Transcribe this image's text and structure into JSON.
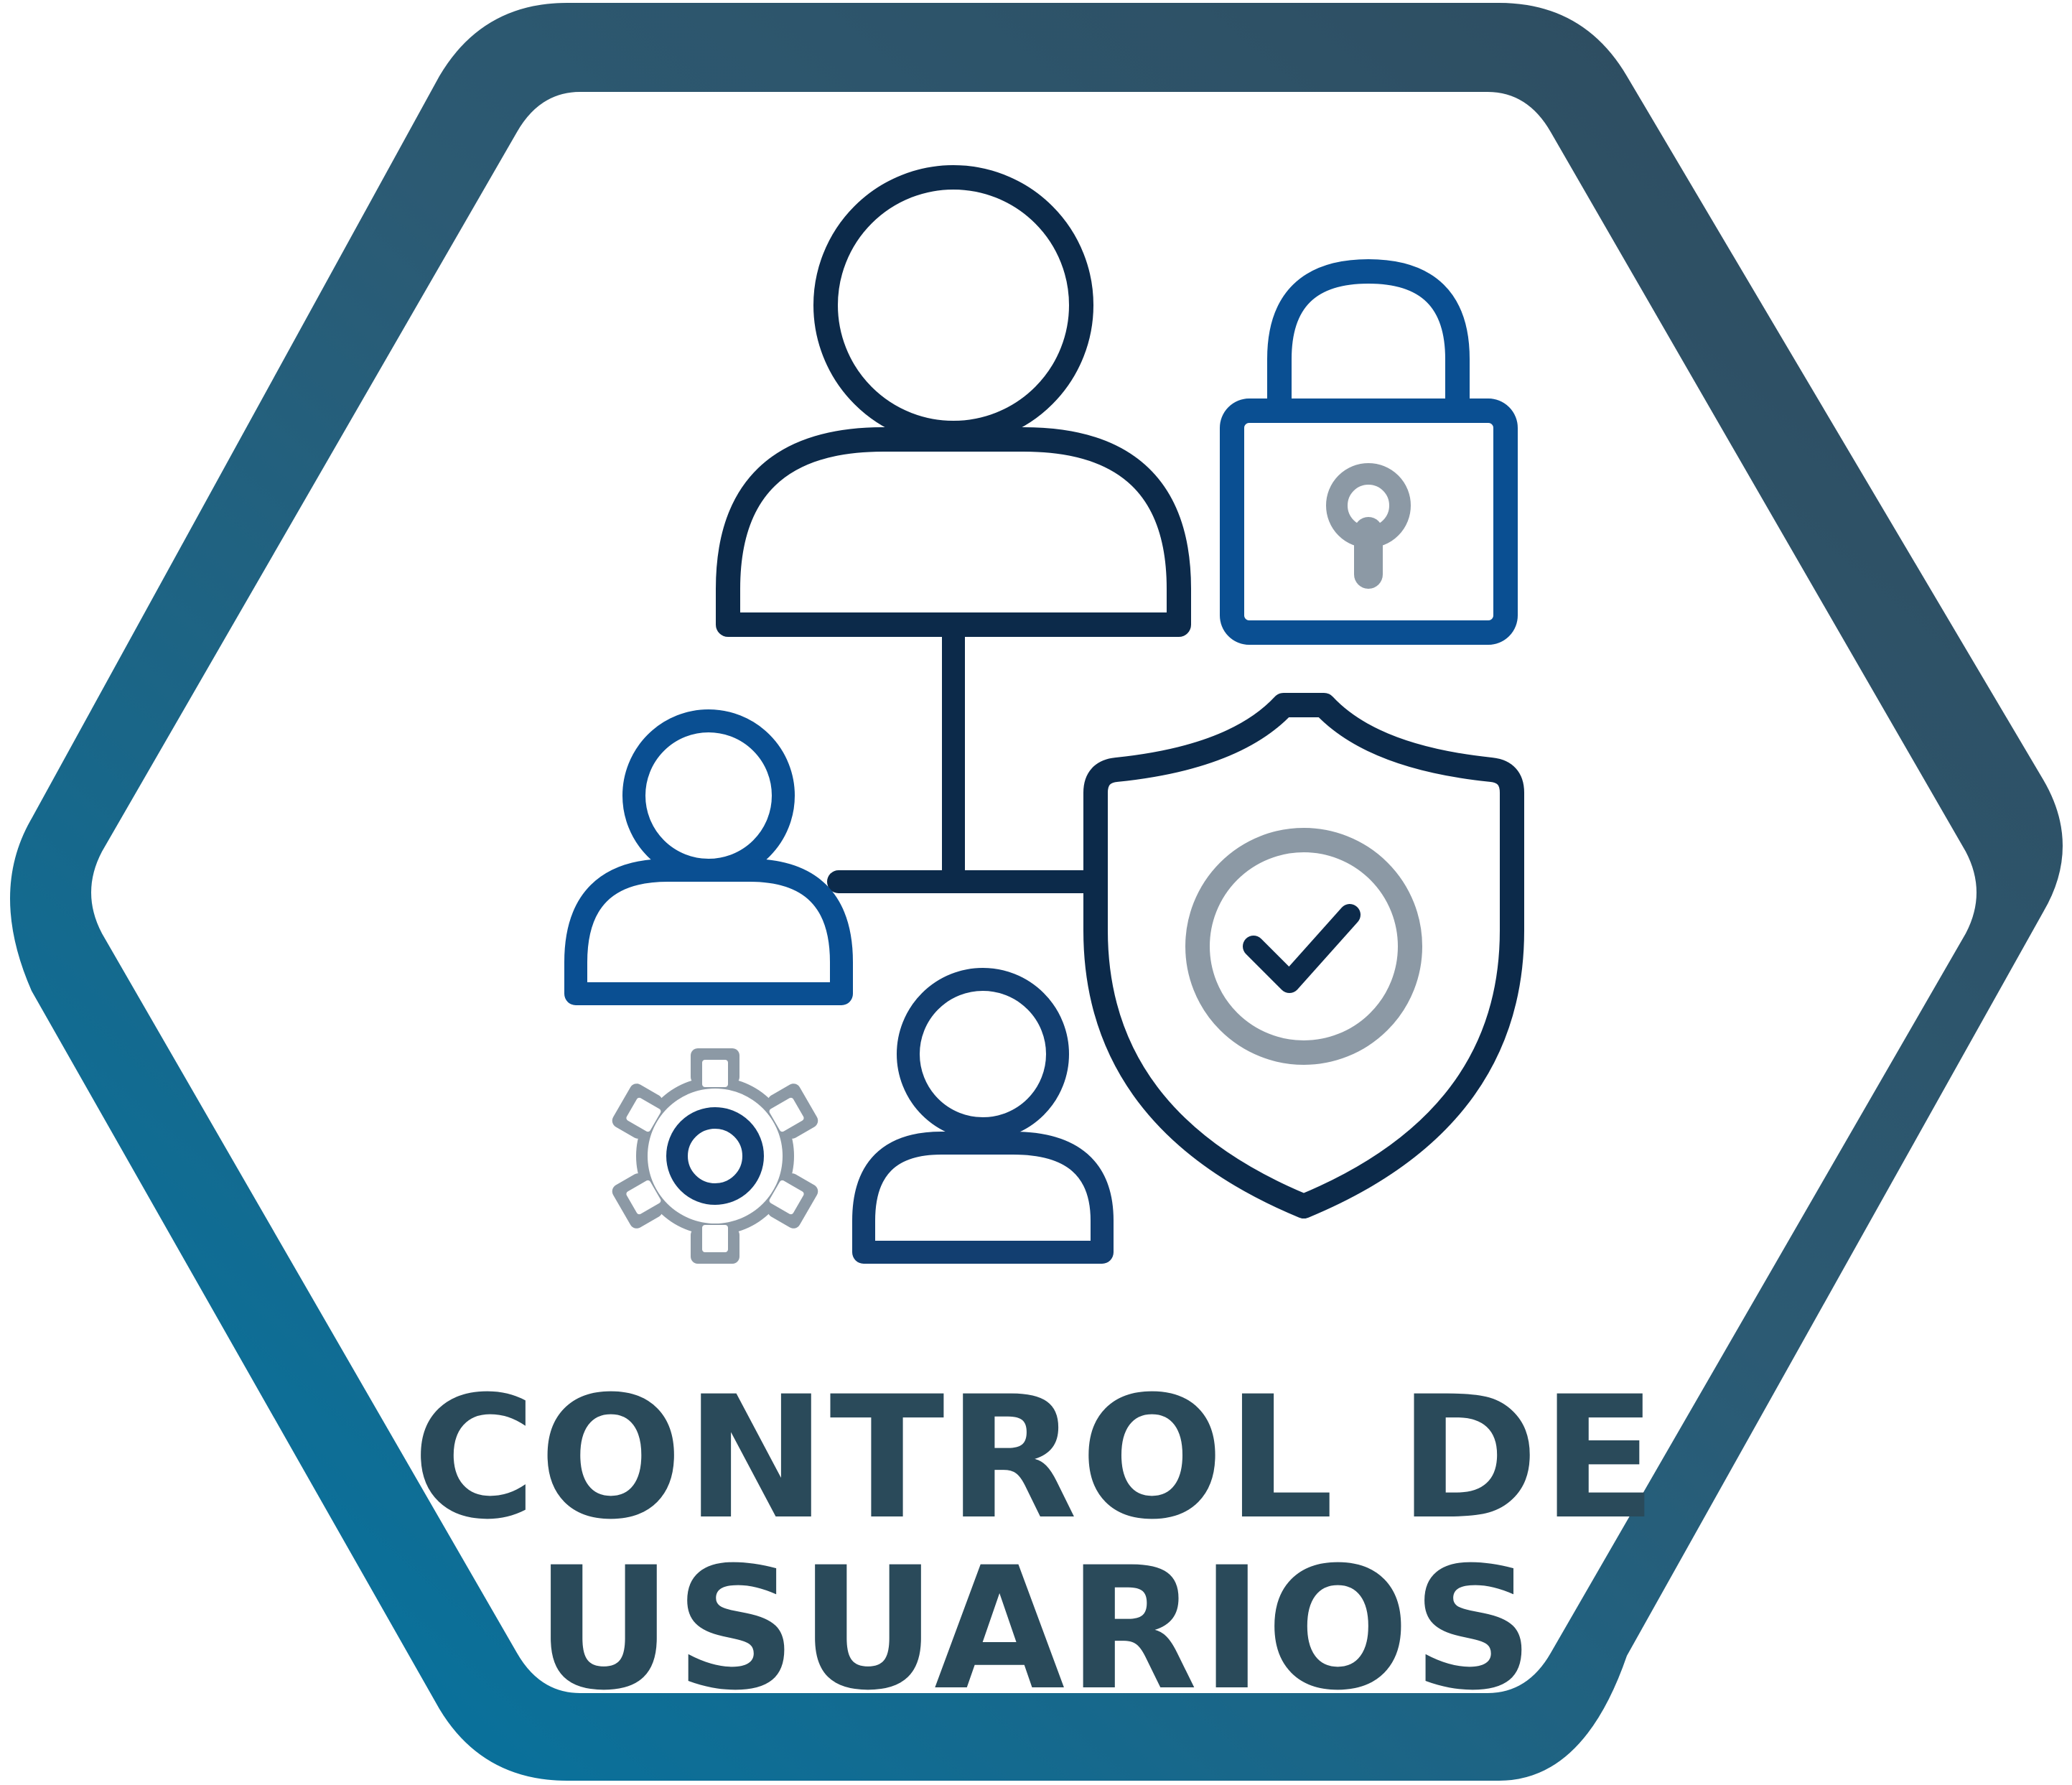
{
  "badge": {
    "title_line1": "CONTROL DE",
    "title_line2": "USUARIOS"
  },
  "icons": {
    "main_user": "user-icon",
    "padlock": "padlock-icon",
    "left_user": "user-icon",
    "bottom_user": "user-icon",
    "gear": "gear-icon",
    "shield": "shield-check-icon"
  },
  "colors": {
    "frame_gradient_start": "#0077A6",
    "frame_gradient_end": "#2F4A5C",
    "navy": "#0C2A4A",
    "blue": "#0A4F92",
    "gray": "#8C99A5",
    "text": "#2A4A5A",
    "background": "#FFFFFF"
  }
}
